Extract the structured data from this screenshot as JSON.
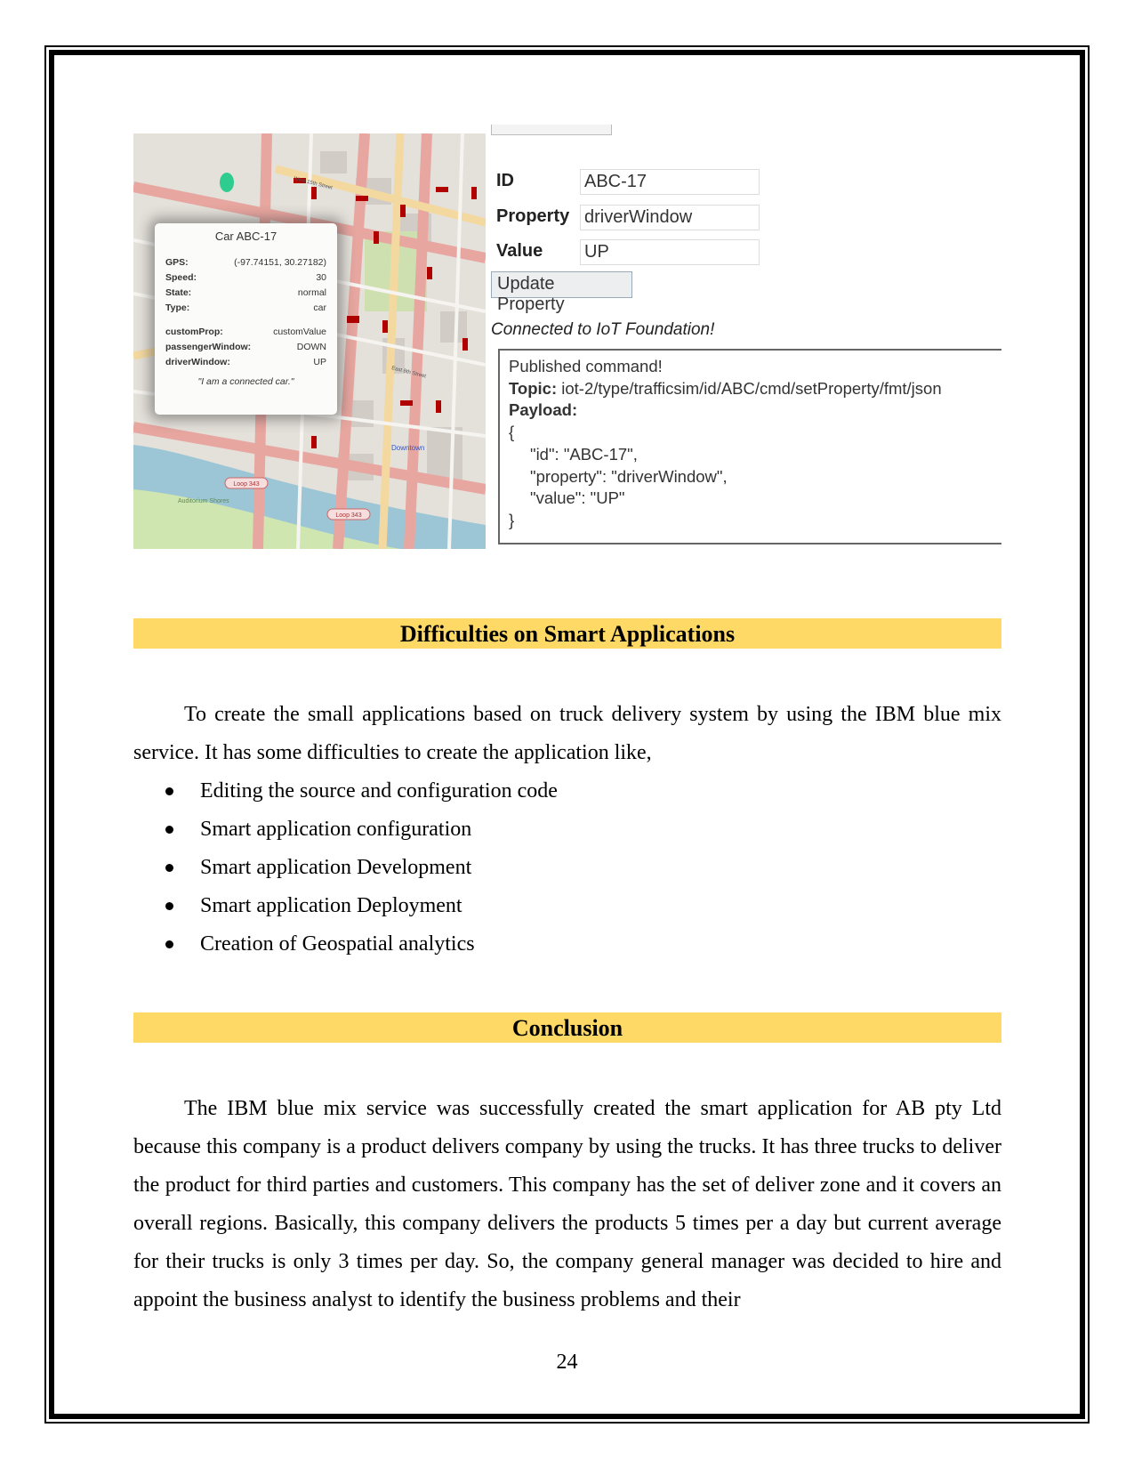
{
  "figure": {
    "map": {
      "popup": {
        "title": "Car ABC-17",
        "rows": [
          {
            "label": "GPS:",
            "value": "(-97.74151, 30.27182)"
          },
          {
            "label": "Speed:",
            "value": "30"
          },
          {
            "label": "State:",
            "value": "normal"
          },
          {
            "label": "Type:",
            "value": "car"
          }
        ],
        "custom_rows": [
          {
            "label": "customProp:",
            "value": "customValue"
          },
          {
            "label": "passengerWindow:",
            "value": "DOWN"
          },
          {
            "label": "driverWindow:",
            "value": "UP"
          }
        ],
        "quote": "\"I am a connected car.\""
      },
      "labels": {
        "downtown": "Downtown",
        "loop1": "Loop 343",
        "loop2": "Loop 343",
        "park": "Auditorium Shores",
        "street1": "West 15th Street",
        "street2": "East 8th Street"
      },
      "colors": {
        "roads": "#e8a6a0",
        "major": "#f3d9a0",
        "cars": "#b00000",
        "marker": "#2ecc8f"
      }
    },
    "panel": {
      "id_label": "ID",
      "id_value": "ABC-17",
      "property_label": "Property",
      "property_value": "driverWindow",
      "value_label": "Value",
      "value_value": "UP",
      "update_button": "Update Property",
      "status": "Connected to IoT Foundation!",
      "console": {
        "line1": "Published command!",
        "topic_label": "Topic:",
        "topic_value": " iot-2/type/trafficsim/id/ABC/cmd/setProperty/fmt/json",
        "payload_label": "Payload:",
        "open": "{",
        "l1": "\"id\": \"ABC-17\",",
        "l2": "\"property\": \"driverWindow\",",
        "l3": "\"value\": \"UP\"",
        "close": "}"
      }
    }
  },
  "section1": {
    "heading": "Difficulties on Smart Applications",
    "paragraph": "To create the small applications based on truck delivery system by using the IBM blue mix service. It has some difficulties to create the application like,",
    "bullets": [
      "Editing the source and configuration code",
      "Smart application configuration",
      "Smart application Development",
      "Smart application Deployment",
      "Creation of Geospatial analytics"
    ]
  },
  "section2": {
    "heading": "Conclusion",
    "paragraph": "The IBM blue mix service was successfully created the smart application for AB pty Ltd because this company is a product delivers company by using the trucks. It has three trucks to deliver the product for third parties and customers. This company has the set of deliver zone and it covers an overall regions. Basically, this company delivers the products 5 times per a day but current average for their trucks is only 3 times per day. So, the company general manager was decided to hire and appoint the business analyst to identify the business problems and their"
  },
  "page_number": "24",
  "colors": {
    "heading_band": "#ffd966"
  }
}
